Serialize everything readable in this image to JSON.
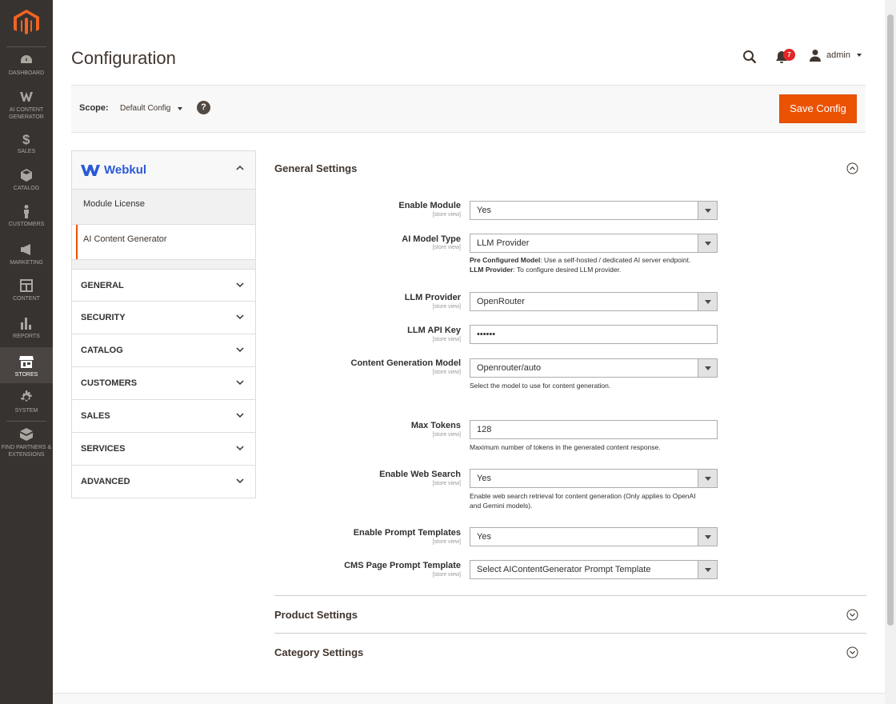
{
  "sidebar": {
    "items": [
      {
        "label": "DASHBOARD",
        "icon": "dashboard-icon"
      },
      {
        "label": "AI CONTENT GENERATOR",
        "icon": "webkul-w-icon"
      },
      {
        "label": "SALES",
        "icon": "dollar-icon"
      },
      {
        "label": "CATALOG",
        "icon": "cube-icon"
      },
      {
        "label": "CUSTOMERS",
        "icon": "person-icon"
      },
      {
        "label": "MARKETING",
        "icon": "megaphone-icon"
      },
      {
        "label": "CONTENT",
        "icon": "layout-icon"
      },
      {
        "label": "REPORTS",
        "icon": "bar-chart-icon"
      },
      {
        "label": "STORES",
        "icon": "store-icon"
      },
      {
        "label": "SYSTEM",
        "icon": "gear-icon"
      },
      {
        "label": "FIND PARTNERS & EXTENSIONS",
        "icon": "box-icon"
      }
    ],
    "active": "STORES"
  },
  "header": {
    "title": "Configuration",
    "notifications_count": "7",
    "user": "admin"
  },
  "scope": {
    "label": "Scope:",
    "value": "Default Config",
    "help": "?",
    "save_label": "Save Config"
  },
  "config_nav": {
    "tab_name": "Webkul",
    "sub_items": [
      "Module License",
      "AI Content Generator"
    ],
    "active_sub": "AI Content Generator",
    "sections": [
      "GENERAL",
      "SECURITY",
      "CATALOG",
      "CUSTOMERS",
      "SALES",
      "SERVICES",
      "ADVANCED"
    ]
  },
  "main": {
    "general_title": "General Settings",
    "product_title": "Product Settings",
    "category_title": "Category Settings",
    "scope_text": "[store view]",
    "fields": {
      "enable_module": {
        "label": "Enable Module",
        "value": "Yes"
      },
      "ai_model_type": {
        "label": "AI Model Type",
        "value": "LLM Provider",
        "note1_bold": "Pre Configured Model",
        "note1_text": ": Use a self-hosted / dedicated AI server endpoint.",
        "note2_bold": "LLM Provider",
        "note2_text": ": To configure desired LLM provider."
      },
      "llm_provider": {
        "label": "LLM Provider",
        "value": "OpenRouter"
      },
      "llm_api_key": {
        "label": "LLM API Key",
        "value": "••••••"
      },
      "content_model": {
        "label": "Content Generation Model",
        "value": "Openrouter/auto",
        "note": "Select the model to use for content generation."
      },
      "max_tokens": {
        "label": "Max Tokens",
        "value": "128",
        "note": "Maximum number of tokens in the generated content response."
      },
      "web_search": {
        "label": "Enable Web Search",
        "value": "Yes",
        "note": "Enable web search retrieval for content generation (Only applies to OpenAI and Gemini models)."
      },
      "prompt_templates": {
        "label": "Enable Prompt Templates",
        "value": "Yes"
      },
      "cms_prompt": {
        "label": "CMS Page Prompt Template",
        "value": "Select AIContentGenerator Prompt Template"
      }
    }
  },
  "colors": {
    "sidebar_bg": "#373330",
    "accent": "#eb5202",
    "webkul_blue": "#2a5ad7",
    "badge_red": "#e22626"
  }
}
